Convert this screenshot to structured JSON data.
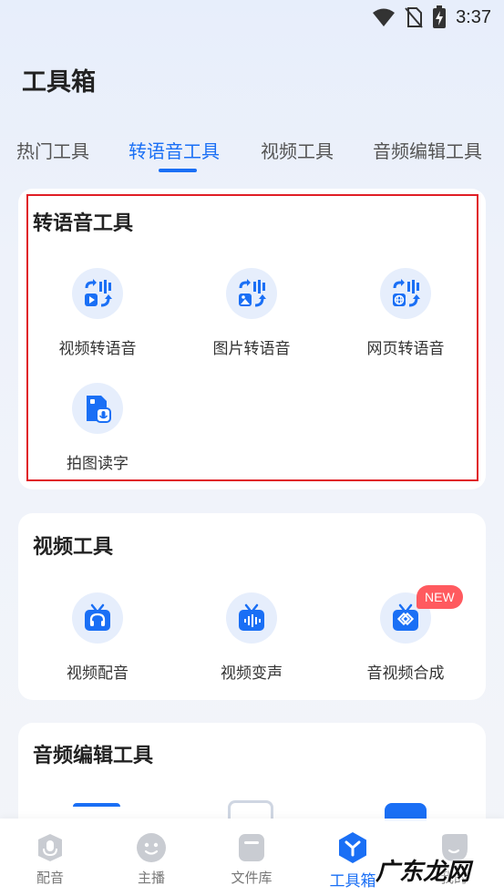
{
  "status_bar": {
    "time": "3:37"
  },
  "page": {
    "title": "工具箱"
  },
  "tabs": [
    {
      "label": "热门工具"
    },
    {
      "label": "转语音工具"
    },
    {
      "label": "视频工具"
    },
    {
      "label": "音频编辑工具"
    }
  ],
  "active_tab": "转语音工具",
  "sections": {
    "tts": {
      "title": "转语音工具",
      "items": [
        {
          "label": "视频转语音",
          "icon": "video-to-speech-icon"
        },
        {
          "label": "图片转语音",
          "icon": "image-to-speech-icon"
        },
        {
          "label": "网页转语音",
          "icon": "web-to-speech-icon"
        },
        {
          "label": "拍图读字",
          "icon": "photo-read-text-icon"
        }
      ]
    },
    "video": {
      "title": "视频工具",
      "items": [
        {
          "label": "视频配音",
          "icon": "video-dubbing-icon"
        },
        {
          "label": "视频变声",
          "icon": "voice-change-icon"
        },
        {
          "label": "音视频合成",
          "icon": "av-merge-icon",
          "badge": "NEW"
        }
      ]
    },
    "audio": {
      "title": "音频编辑工具"
    }
  },
  "bottom_nav": [
    {
      "label": "配音",
      "icon": "dubbing-icon"
    },
    {
      "label": "主播",
      "icon": "anchor-face-icon"
    },
    {
      "label": "文件库",
      "icon": "file-library-icon"
    },
    {
      "label": "工具箱",
      "icon": "toolbox-icon",
      "active": true
    },
    {
      "label": "我的",
      "icon": "profile-icon"
    }
  ],
  "watermark": {
    "text": "广东龙网"
  },
  "colors": {
    "accent": "#1a6ff5",
    "icon_bg": "#e6eefc",
    "highlight": "#e01e26",
    "badge": "#ff5a5f"
  }
}
